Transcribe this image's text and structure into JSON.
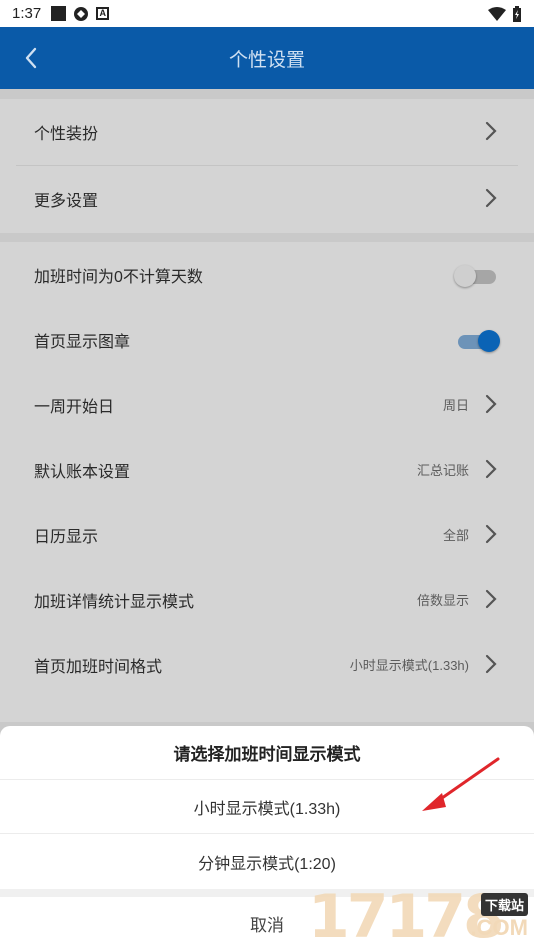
{
  "status_bar": {
    "time": "1:37"
  },
  "header": {
    "title": "个性设置"
  },
  "settings": {
    "group1": [
      {
        "label": "个性装扮"
      },
      {
        "label": "更多设置"
      }
    ],
    "group2": [
      {
        "label": "加班时间为0不计算天数",
        "toggle": "off"
      },
      {
        "label": "首页显示图章",
        "toggle": "on"
      },
      {
        "label": "一周开始日",
        "value": "周日"
      },
      {
        "label": "默认账本设置",
        "value": "汇总记账"
      },
      {
        "label": "日历显示",
        "value": "全部"
      },
      {
        "label": "加班详情统计显示模式",
        "value": "倍数显示"
      },
      {
        "label": "首页加班时间格式",
        "value": "小时显示模式(1.33h)"
      }
    ]
  },
  "sheet": {
    "title": "请选择加班时间显示模式",
    "options": [
      "小时显示模式(1.33h)",
      "分钟显示模式(1:20)"
    ],
    "cancel": "取消"
  },
  "watermark": {
    "digits": "17178",
    "badge": "下载站",
    "domain": ".COM"
  },
  "colors": {
    "header": "#0a5aa8",
    "accent": "#0a63b5",
    "arrow": "#e0262b"
  }
}
